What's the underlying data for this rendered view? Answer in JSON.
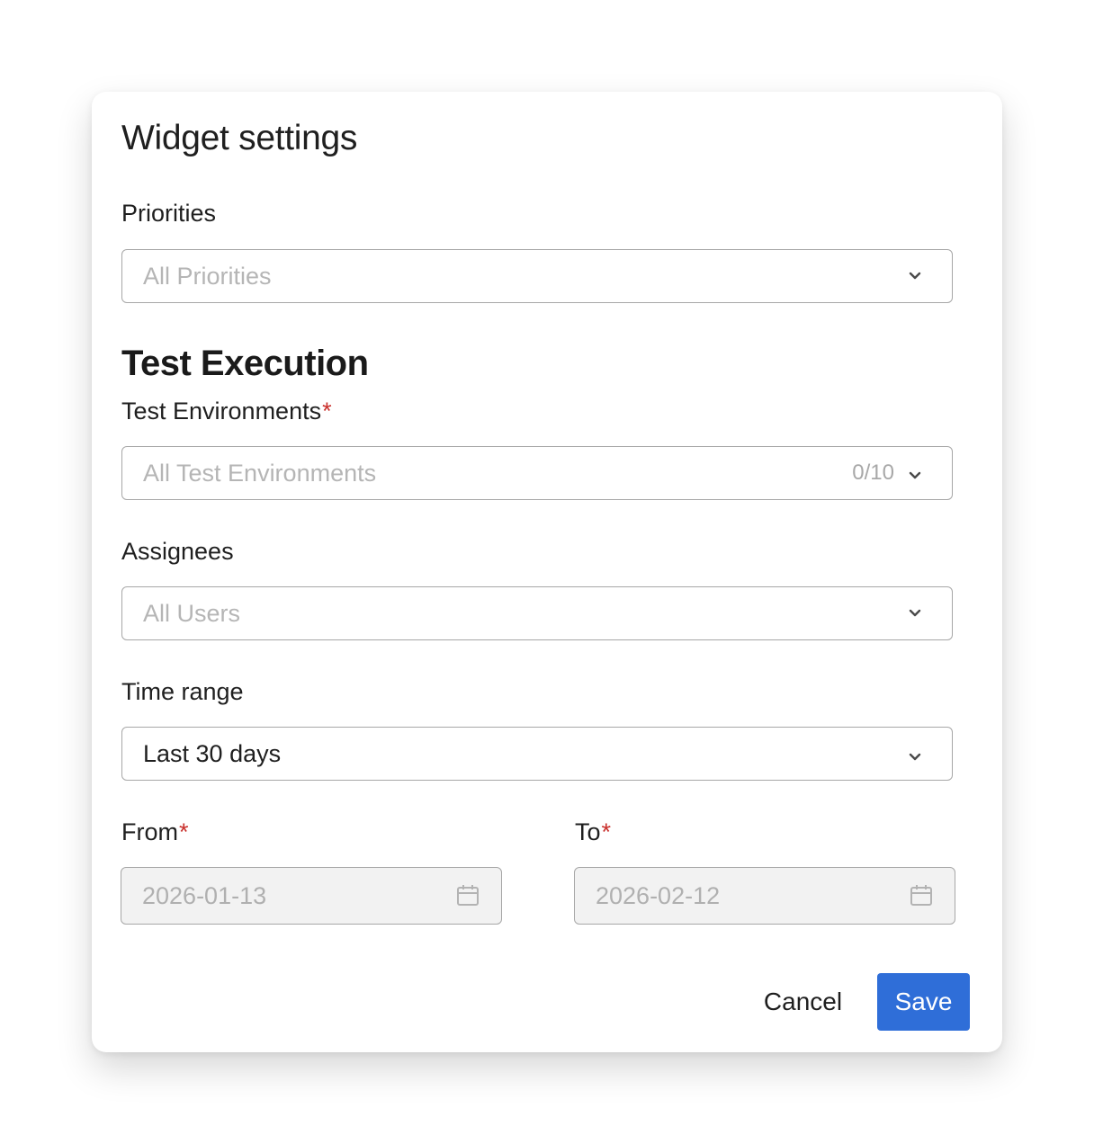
{
  "dialog": {
    "title": "Widget settings",
    "section_title": "Test Execution"
  },
  "fields": {
    "priorities": {
      "label": "Priorities",
      "placeholder": "All Priorities"
    },
    "test_environments": {
      "label": "Test Environments",
      "required_mark": "*",
      "placeholder": "All Test Environments",
      "count": "0/10"
    },
    "assignees": {
      "label": "Assignees",
      "placeholder": "All Users"
    },
    "time_range": {
      "label": "Time range",
      "value": "Last 30 days"
    },
    "from": {
      "label": "From",
      "required_mark": "*",
      "value": "2026-01-13"
    },
    "to": {
      "label": "To",
      "required_mark": "*",
      "value": "2026-02-12"
    }
  },
  "actions": {
    "cancel_label": "Cancel",
    "save_label": "Save"
  },
  "colors": {
    "primary": "#2f6ed8",
    "required": "#c9302c",
    "placeholder": "#b5b5b5",
    "disabled_bg": "#f2f2f2"
  },
  "icons": {
    "dropdown": "chevron-down-icon",
    "date": "calendar-icon"
  }
}
